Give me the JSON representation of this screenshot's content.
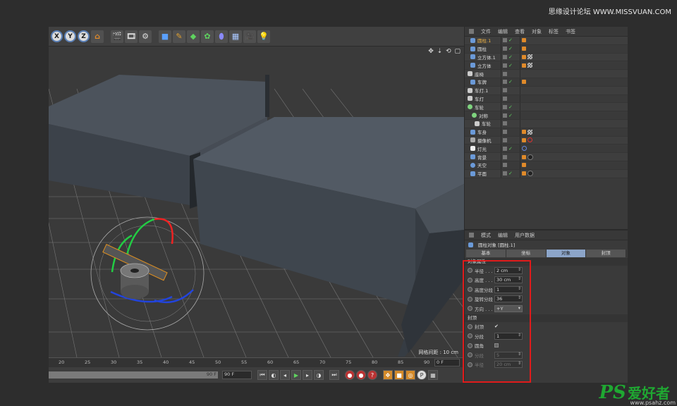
{
  "watermark": {
    "top": "思缘设计论坛 WWW.MISSVUAN.COM",
    "logo": "PS",
    "cn": "爱好者",
    "url": "www.psahz.com"
  },
  "toolbar": {
    "axes": [
      "X",
      "Y",
      "Z"
    ],
    "icons": [
      "coordinate-system-icon",
      "render-view-icon",
      "render-picture-icon",
      "render-settings-icon",
      "cube-icon",
      "pen-icon",
      "subdivision-icon",
      "cloner-icon",
      "deformer-icon",
      "floor-icon",
      "camera-icon",
      "light-icon"
    ]
  },
  "viewport": {
    "nav_icons": "✥ ⇣ ⟲ ▢",
    "grid_spacing": "网格间距 : 10 cm"
  },
  "timeline": {
    "ticks": [
      "20",
      "25",
      "30",
      "35",
      "40",
      "45",
      "50",
      "55",
      "60",
      "65",
      "70",
      "75",
      "80",
      "85",
      "90"
    ],
    "current_frame": "0 F"
  },
  "playbar": {
    "range_end": "90 F",
    "end_frame": "90 F"
  },
  "object_manager": {
    "menu": [
      "文件",
      "编辑",
      "查看",
      "对象",
      "标签",
      "书签"
    ],
    "objects": [
      {
        "name": "圆柱.1",
        "selected": true,
        "indent": 1,
        "color": "#6b9ad8"
      },
      {
        "name": "圆柱",
        "selected": false,
        "indent": 1,
        "color": "#6b9ad8"
      },
      {
        "name": "立方体.1",
        "selected": false,
        "indent": 1,
        "color": "#6b9ad8"
      },
      {
        "name": "立方体",
        "selected": false,
        "indent": 1,
        "color": "#6b9ad8"
      },
      {
        "name": "座椅",
        "selected": false,
        "indent": 0,
        "color": "#cccccc"
      },
      {
        "name": "车牌",
        "selected": false,
        "indent": 1,
        "color": "#6b9ad8"
      },
      {
        "name": "车灯.1",
        "selected": false,
        "indent": 0,
        "color": "#cccccc"
      },
      {
        "name": "车灯",
        "selected": false,
        "indent": 0,
        "color": "#cccccc"
      },
      {
        "name": "车轮",
        "selected": false,
        "indent": 0,
        "color": "#7ed37e"
      },
      {
        "name": "对称",
        "selected": false,
        "indent": 1,
        "color": "#7ed37e"
      },
      {
        "name": "车轮",
        "selected": false,
        "indent": 2,
        "color": "#cccccc"
      },
      {
        "name": "车身",
        "selected": false,
        "indent": 1,
        "color": "#6b9ad8"
      },
      {
        "name": "摄像机",
        "selected": false,
        "indent": 1,
        "color": "#aaaaaa"
      },
      {
        "name": "灯光",
        "selected": false,
        "indent": 1,
        "color": "#eeeeee"
      },
      {
        "name": "背景",
        "selected": false,
        "indent": 1,
        "color": "#6b9ad8"
      },
      {
        "name": "天空",
        "selected": false,
        "indent": 1,
        "color": "#6b9ad8"
      },
      {
        "name": "平面",
        "selected": false,
        "indent": 1,
        "color": "#6b9ad8"
      }
    ]
  },
  "attribute_manager": {
    "menu": [
      "模式",
      "编辑",
      "用户数据"
    ],
    "title": "圆柱对象 [圆柱.1]",
    "tabs": [
      "基本",
      "坐标",
      "对象",
      "封顶"
    ],
    "active_tab": 2,
    "object_section": "对象属性",
    "fields": [
      {
        "label": "半径 . . .",
        "value": "2 cm"
      },
      {
        "label": "高度 . . .",
        "value": "30 cm"
      },
      {
        "label": "高度分段",
        "value": "1"
      },
      {
        "label": "旋转分段",
        "value": "36"
      }
    ],
    "orientation_label": "方向 . . .",
    "orientation_value": "+Y",
    "caps_section": "封顶",
    "caps_label": "封顶",
    "caps_checked": "✔",
    "segments_label": "分段",
    "segments_value": "1",
    "fillet_label": "圆角",
    "fillet_segments_label": "分段",
    "fillet_segments_value": "5",
    "fillet_radius_label": "半径",
    "fillet_radius_value": "20 cm"
  },
  "colors": {
    "highlight": "#e01b1b",
    "selected": "#f0b446",
    "tab_active": "#8ca5c9"
  }
}
